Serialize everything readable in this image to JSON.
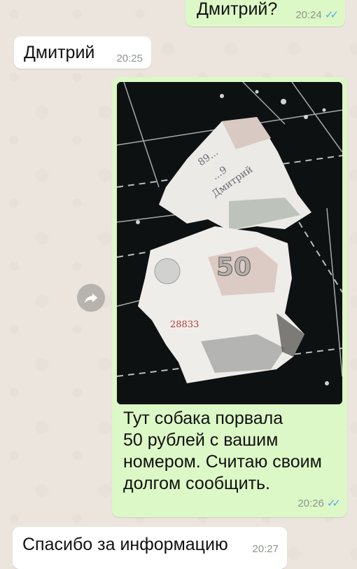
{
  "messages": [
    {
      "text": "Дмитрий?",
      "time": "20:24",
      "ticks": "✓✓"
    },
    {
      "text": "Дмитрий",
      "time": "20:25"
    },
    {
      "text": "Тут собака порвала\n50 рублей с вашим\nномером. Считаю своим\nдолгом сообщить.",
      "time": "20:26",
      "ticks": "✓✓"
    },
    {
      "text": "Спасибо за информацию",
      "time": "20:27"
    }
  ],
  "photo": {
    "banknote_value": "50",
    "serial_fragment": "28833",
    "handwriting_lines": [
      "89...",
      "...9",
      "Дмитрий"
    ]
  },
  "icons": {
    "forward": "forward-arrow-icon",
    "read_receipt": "double-check-icon"
  },
  "colors": {
    "outgoing": "#dcf8c6",
    "incoming": "#ffffff",
    "background": "#ece5dd",
    "ticks": "#4fa9e8"
  }
}
